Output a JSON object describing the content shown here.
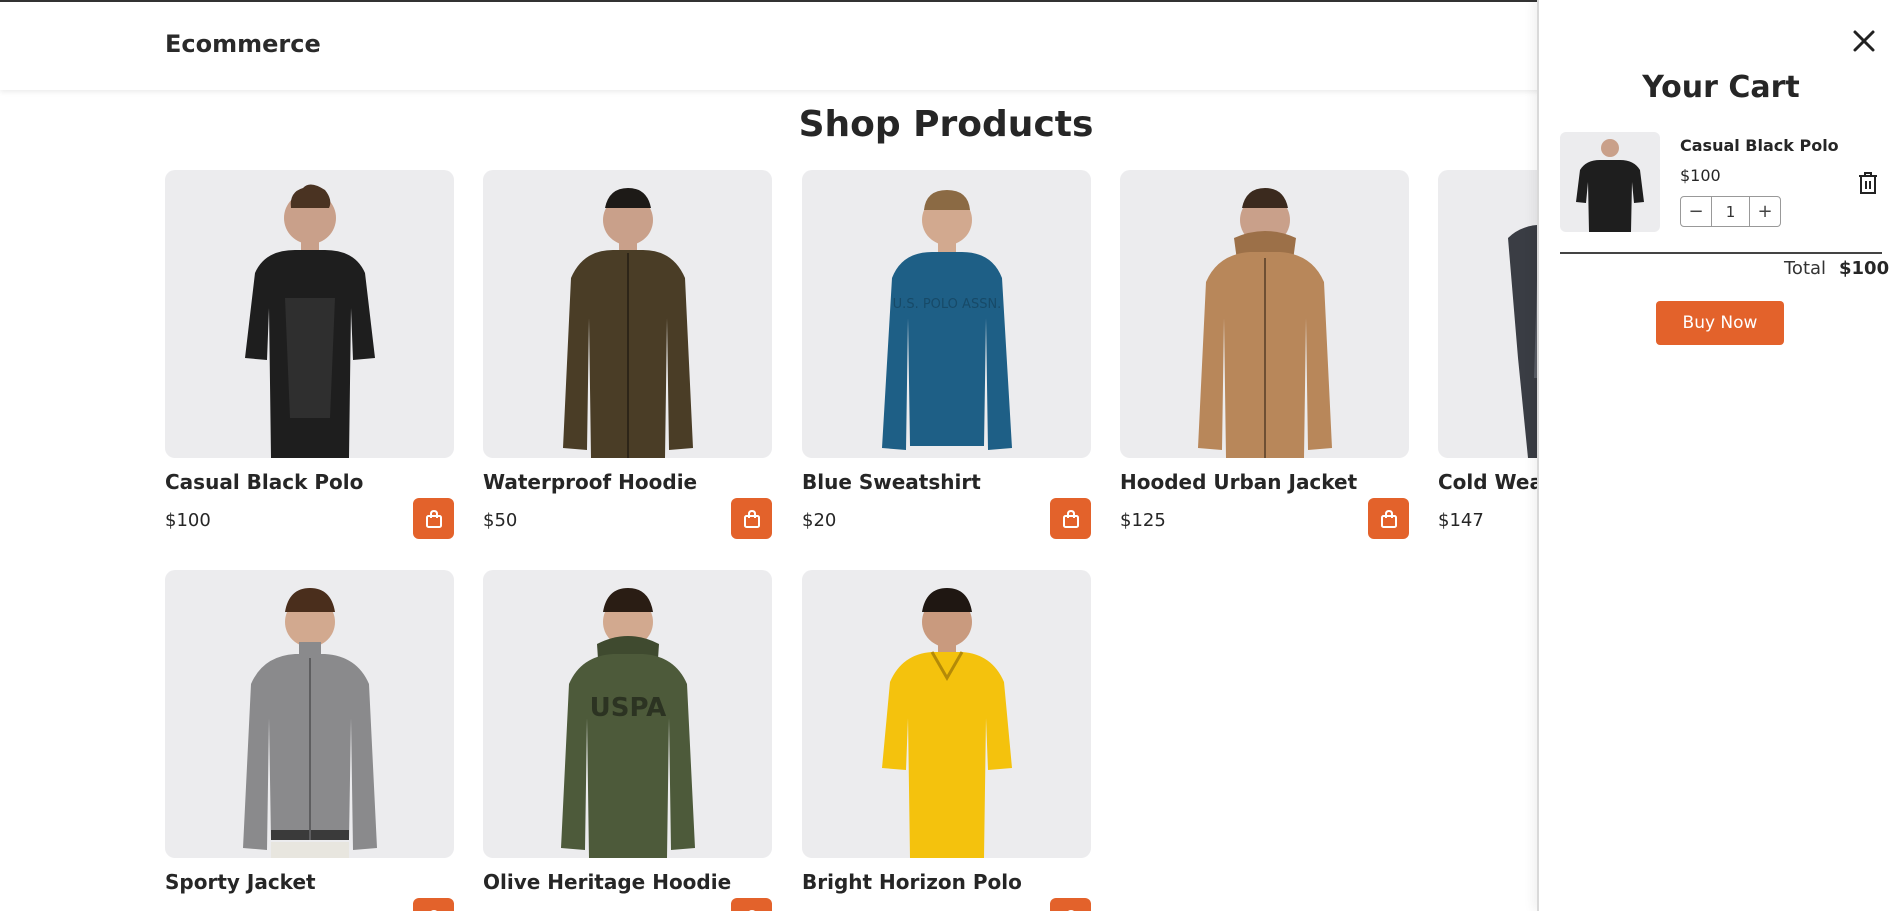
{
  "header": {
    "brand": "Ecommerce"
  },
  "main": {
    "title": "Shop Products"
  },
  "products": [
    {
      "name": "Casual Black Polo",
      "price": "$100",
      "color": "#1e1e1e"
    },
    {
      "name": "Waterproof Hoodie",
      "price": "$50",
      "color": "#4a3d26"
    },
    {
      "name": "Blue Sweatshirt",
      "price": "$20",
      "color": "#1e5f86"
    },
    {
      "name": "Hooded Urban Jacket",
      "price": "$125",
      "color": "#b8875a"
    },
    {
      "name": "Cold Weat",
      "price": "$147",
      "color": "#3a3d44"
    },
    {
      "name": "Sporty Jacket",
      "price": "",
      "color": "#8a8a8c"
    },
    {
      "name": "Olive Heritage Hoodie",
      "price": "",
      "color": "#4d5a3a"
    },
    {
      "name": "Bright Horizon Polo",
      "price": "",
      "color": "#f4c20d"
    }
  ],
  "cart": {
    "title": "Your Cart",
    "item": {
      "name": "Casual Black Polo",
      "price": "$100",
      "qty": "1",
      "minus": "−",
      "plus": "+"
    },
    "total_label": "Total",
    "total_value": "$100",
    "buy_label": "Buy Now"
  },
  "colors": {
    "accent": "#e3622b",
    "card_bg": "#ececee"
  },
  "icons": {
    "cart_button": "shopping-bag-icon",
    "close": "close-icon",
    "delete": "trash-icon"
  }
}
